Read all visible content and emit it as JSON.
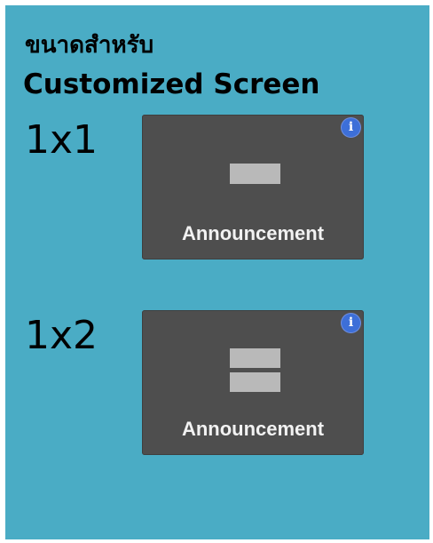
{
  "header": {
    "title_thai": "ขนาดสำหรับ",
    "title_english": "Customized Screen"
  },
  "options": [
    {
      "size_label": "1x1",
      "tile_label": "Announcement",
      "info_icon": "i",
      "layout_bars": 1
    },
    {
      "size_label": "1x2",
      "tile_label": "Announcement",
      "info_icon": "i",
      "layout_bars": 2
    }
  ],
  "colors": {
    "panel_background": "#4aacc5",
    "tile_background": "#4e4e4e",
    "bar_color": "#b9b9b9",
    "info_icon_color": "#3d6fd8"
  }
}
